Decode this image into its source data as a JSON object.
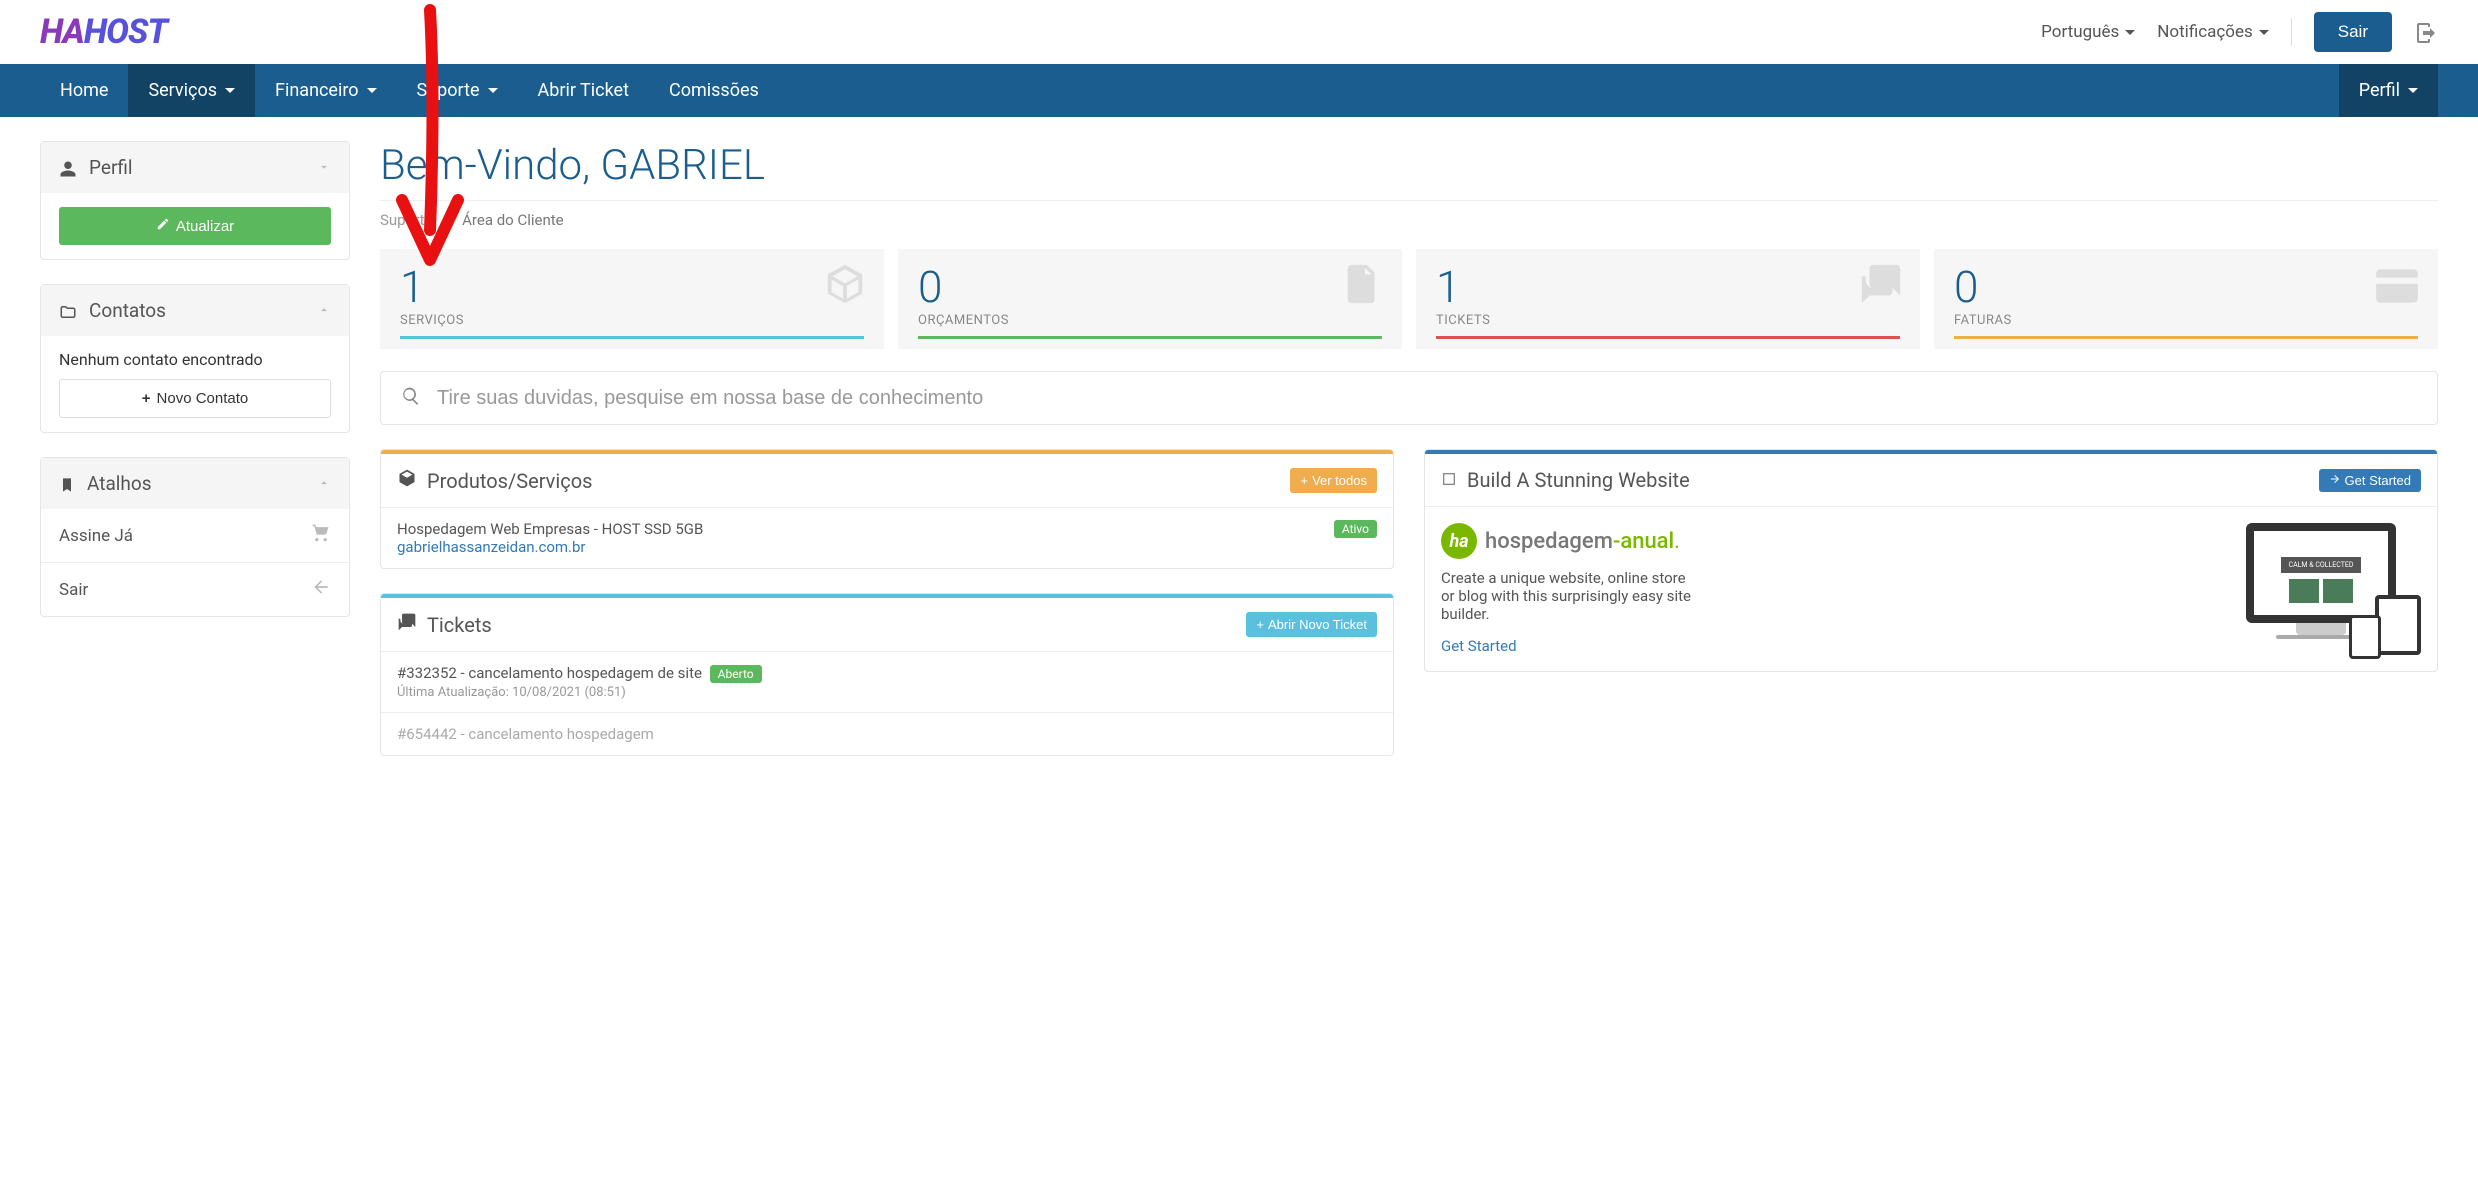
{
  "logo": {
    "text": "HAHOST",
    "color1": "#8a3ab9",
    "color2": "#5851db"
  },
  "topbar": {
    "language": "Português",
    "notifications": "Notificações",
    "logout": "Sair"
  },
  "nav": {
    "home": "Home",
    "services": "Serviços",
    "financial": "Financeiro",
    "support": "Suporte",
    "open_ticket": "Abrir Ticket",
    "commissions": "Comissões",
    "profile": "Perfil"
  },
  "sidebar": {
    "profile": {
      "title": "Perfil",
      "update": "Atualizar"
    },
    "contacts": {
      "title": "Contatos",
      "empty": "Nenhum contato encontrado",
      "new": "Novo Contato"
    },
    "shortcuts": {
      "title": "Atalhos",
      "subscribe": "Assine Já",
      "logout": "Sair"
    }
  },
  "welcome": "Bem-Vindo, GABRIEL",
  "breadcrumb": {
    "a": "Suporte",
    "b": "Área do Cliente"
  },
  "stats": {
    "services": {
      "value": "1",
      "label": "SERVIÇOS",
      "color": "#5bc0de"
    },
    "quotes": {
      "value": "0",
      "label": "ORÇAMENTOS",
      "color": "#5cb85c"
    },
    "tickets": {
      "value": "1",
      "label": "TICKETS",
      "color": "#d9534f"
    },
    "invoices": {
      "value": "0",
      "label": "FATURAS",
      "color": "#f0ad4e"
    }
  },
  "search": {
    "placeholder": "Tire suas duvidas, pesquise em nossa base de conhecimento"
  },
  "products": {
    "title": "Produtos/Serviços",
    "view_all": "Ver todos",
    "item": {
      "name": "Hospedagem Web Empresas - HOST SSD 5GB",
      "domain": "gabrielhassanzeidan.com.br",
      "status": "Ativo"
    }
  },
  "tickets": {
    "title": "Tickets",
    "open_new": "Abrir Novo Ticket",
    "item1": {
      "title": "#332352 - cancelamento hospedagem de site",
      "status": "Aberto",
      "meta": "Última Atualização: 10/08/2021 (08:51)"
    },
    "item2": {
      "title": "#654442 - cancelamento hospedagem"
    }
  },
  "promo": {
    "title": "Build A Stunning Website",
    "cta": "Get Started",
    "logo_a": "hospedagem",
    "logo_b": "-anual",
    "desc": "Create a unique website, online store or blog with this surprisingly easy site builder.",
    "link": "Get Started"
  }
}
